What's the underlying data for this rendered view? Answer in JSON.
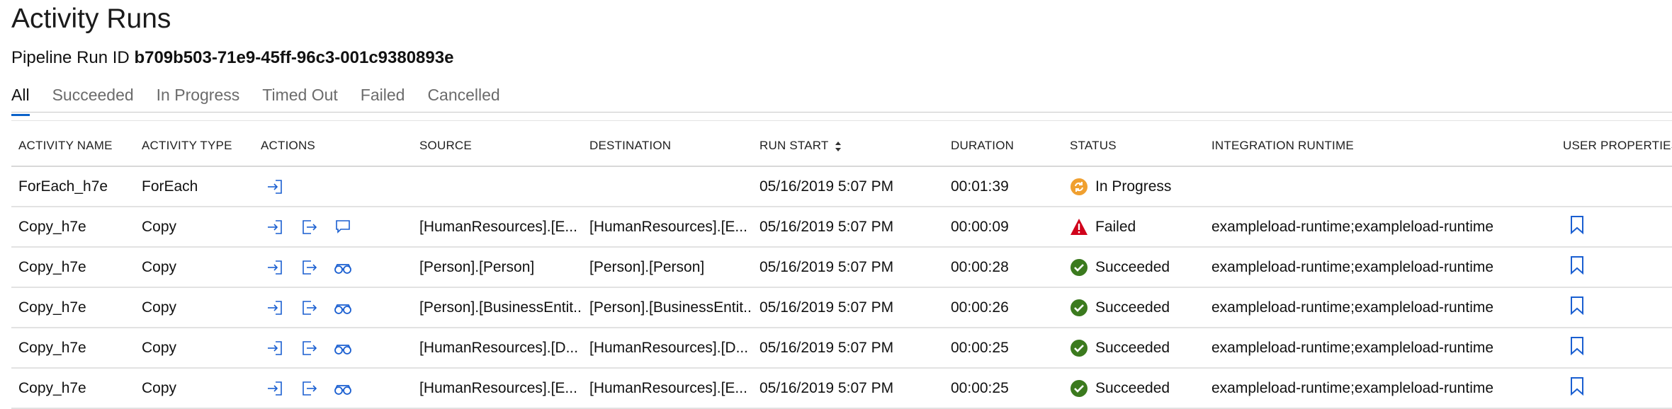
{
  "page": {
    "title": "Activity Runs",
    "run_id_label": "Pipeline Run ID",
    "run_id_value": "b709b503-71e9-45ff-96c3-001c9380893e"
  },
  "tabs": [
    {
      "label": "All",
      "active": true
    },
    {
      "label": "Succeeded",
      "active": false
    },
    {
      "label": "In Progress",
      "active": false
    },
    {
      "label": "Timed Out",
      "active": false
    },
    {
      "label": "Failed",
      "active": false
    },
    {
      "label": "Cancelled",
      "active": false
    }
  ],
  "table": {
    "headers": {
      "activity_name": "ACTIVITY NAME",
      "activity_type": "ACTIVITY TYPE",
      "actions": "ACTIONS",
      "source": "SOURCE",
      "destination": "DESTINATION",
      "run_start": "RUN START",
      "duration": "DURATION",
      "status": "STATUS",
      "integration_runtime": "INTEGRATION RUNTIME",
      "user_properties": "USER PROPERTIES"
    },
    "rows": [
      {
        "name": "ForEach_h7e",
        "type": "ForEach",
        "actions": [
          "input-icon"
        ],
        "source": "",
        "destination": "",
        "run_start": "05/16/2019 5:07 PM",
        "duration": "00:01:39",
        "status": "In Progress",
        "status_icon": "in-progress-icon",
        "runtime": "",
        "user_properties": false
      },
      {
        "name": "Copy_h7e",
        "type": "Copy",
        "actions": [
          "input-icon",
          "output-icon",
          "error-comment-icon"
        ],
        "source": "[HumanResources].[E...",
        "destination": "[HumanResources].[E...",
        "run_start": "05/16/2019 5:07 PM",
        "duration": "00:00:09",
        "status": "Failed",
        "status_icon": "failed-icon",
        "runtime": "exampleload-runtime;exampleload-runtime",
        "user_properties": true
      },
      {
        "name": "Copy_h7e",
        "type": "Copy",
        "actions": [
          "input-icon",
          "output-icon",
          "details-glasses-icon"
        ],
        "source": "[Person].[Person]",
        "destination": "[Person].[Person]",
        "run_start": "05/16/2019 5:07 PM",
        "duration": "00:00:28",
        "status": "Succeeded",
        "status_icon": "succeeded-icon",
        "runtime": "exampleload-runtime;exampleload-runtime",
        "user_properties": true
      },
      {
        "name": "Copy_h7e",
        "type": "Copy",
        "actions": [
          "input-icon",
          "output-icon",
          "details-glasses-icon"
        ],
        "source": "[Person].[BusinessEntit...",
        "destination": "[Person].[BusinessEntit...",
        "run_start": "05/16/2019 5:07 PM",
        "duration": "00:00:26",
        "status": "Succeeded",
        "status_icon": "succeeded-icon",
        "runtime": "exampleload-runtime;exampleload-runtime",
        "user_properties": true
      },
      {
        "name": "Copy_h7e",
        "type": "Copy",
        "actions": [
          "input-icon",
          "output-icon",
          "details-glasses-icon"
        ],
        "source": "[HumanResources].[D...",
        "destination": "[HumanResources].[D...",
        "run_start": "05/16/2019 5:07 PM",
        "duration": "00:00:25",
        "status": "Succeeded",
        "status_icon": "succeeded-icon",
        "runtime": "exampleload-runtime;exampleload-runtime",
        "user_properties": true
      },
      {
        "name": "Copy_h7e",
        "type": "Copy",
        "actions": [
          "input-icon",
          "output-icon",
          "details-glasses-icon"
        ],
        "source": "[HumanResources].[E...",
        "destination": "[HumanResources].[E...",
        "run_start": "05/16/2019 5:07 PM",
        "duration": "00:00:25",
        "status": "Succeeded",
        "status_icon": "succeeded-icon",
        "runtime": "exampleload-runtime;exampleload-runtime",
        "user_properties": true
      }
    ]
  },
  "colors": {
    "accent": "#0b62c9",
    "action_icon": "#1a5fd1",
    "succeeded": "#3b7a1e",
    "failed": "#d0021b",
    "in_progress": "#f0a030"
  }
}
